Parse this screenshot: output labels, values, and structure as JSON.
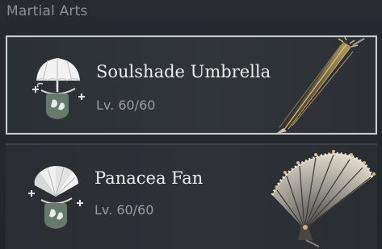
{
  "section": {
    "title": "Martial Arts"
  },
  "arts": [
    {
      "name": "Soulshade Umbrella",
      "level": "Lv. 60/60",
      "icon": "umbrella-skill-icon",
      "weapon_icon": "umbrella-weapon-icon",
      "selected": true
    },
    {
      "name": "Panacea Fan",
      "level": "Lv. 60/60",
      "icon": "fan-skill-icon",
      "weapon_icon": "fan-weapon-icon",
      "selected": false
    }
  ],
  "colors": {
    "background": "#23272c",
    "selected_border": "#c9ccd0",
    "badge": "#667a6c",
    "name_text": "#ececec",
    "level_text": "#9a9ea2"
  }
}
